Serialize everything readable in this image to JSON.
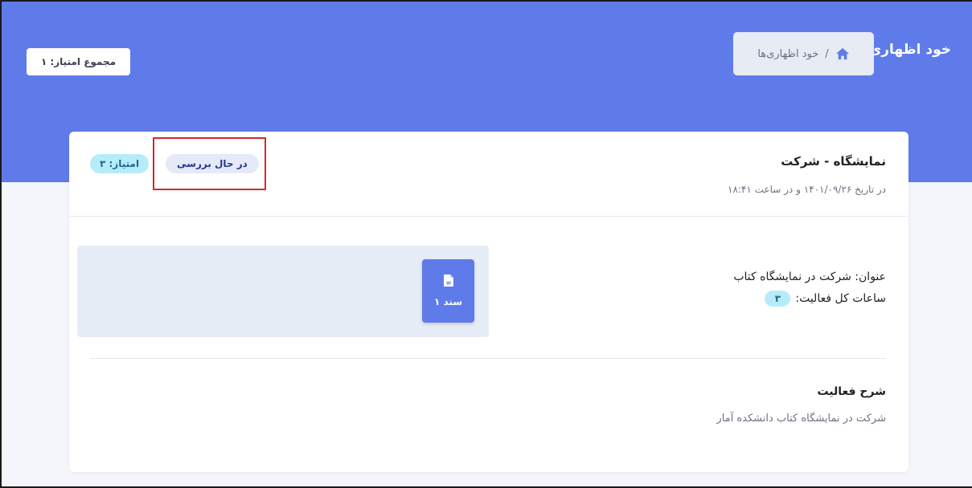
{
  "header": {
    "page_title": "خود اظهاری‌ها",
    "breadcrumb": {
      "separator": "/",
      "current": "خود اظهاری‌ها"
    },
    "total_score_label": "مجموع امتیاز: ۱"
  },
  "card": {
    "title": "نمایشگاه - شرکت",
    "date_text": "در تاریخ ۱۴۰۱/۰۹/۲۶ و در ساعت ۱۸:۴۱",
    "status_badge": "در حال بررسی",
    "score_badge": "امتیاز: ۳",
    "file": {
      "label": "سند ۱",
      "icon": "word-document-icon"
    },
    "info": {
      "title_line": "عنوان: شرکت در نمایشگاه کتاب",
      "hours_label": "ساعات کل فعالیت:",
      "hours_value": "۳"
    },
    "description": {
      "heading": "شرح فعالیت",
      "text": "شرکت در نمایشگاه کتاب دانشکده آمار"
    }
  },
  "colors": {
    "header_bg": "#5f7be9",
    "status_badge_bg": "#e6e9f7",
    "score_badge_bg": "#b6ecfa",
    "highlight_border": "#d62828"
  }
}
